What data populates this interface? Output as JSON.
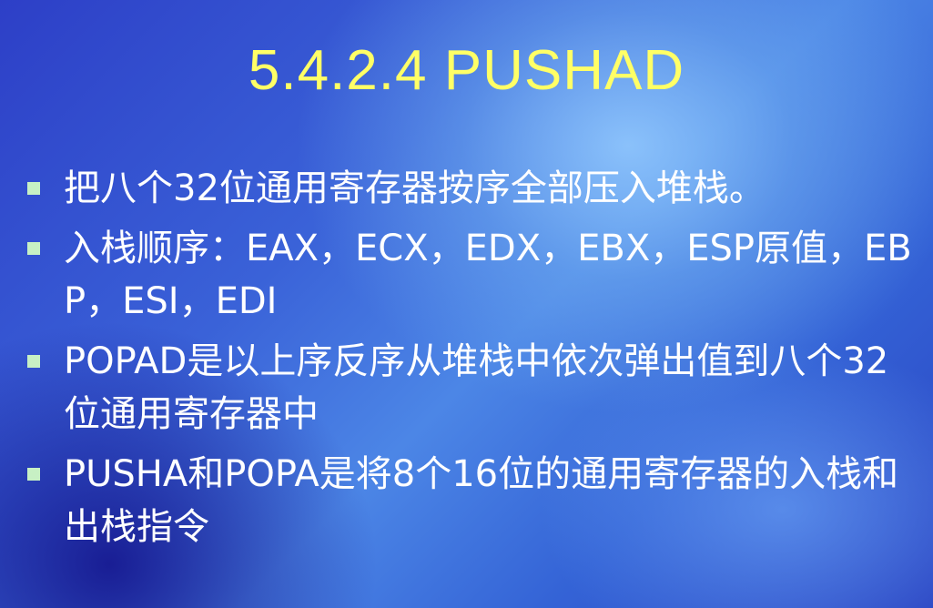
{
  "slide": {
    "title": "5.4.2.4 PUSHAD",
    "bullets": [
      "把八个32位通用寄存器按序全部压入堆栈。",
      "入栈顺序：EAX，ECX，EDX，EBX，ESP原值，EBP，ESI，EDI",
      "POPAD是以上序反序从堆栈中依次弹出值到八个32位通用寄存器中",
      "PUSHA和POPA是将8个16位的通用寄存器的入栈和出栈指令"
    ],
    "colors": {
      "title": "#ffff66",
      "text": "#ffffff",
      "bullet_marker": "#c7f0c4"
    }
  }
}
